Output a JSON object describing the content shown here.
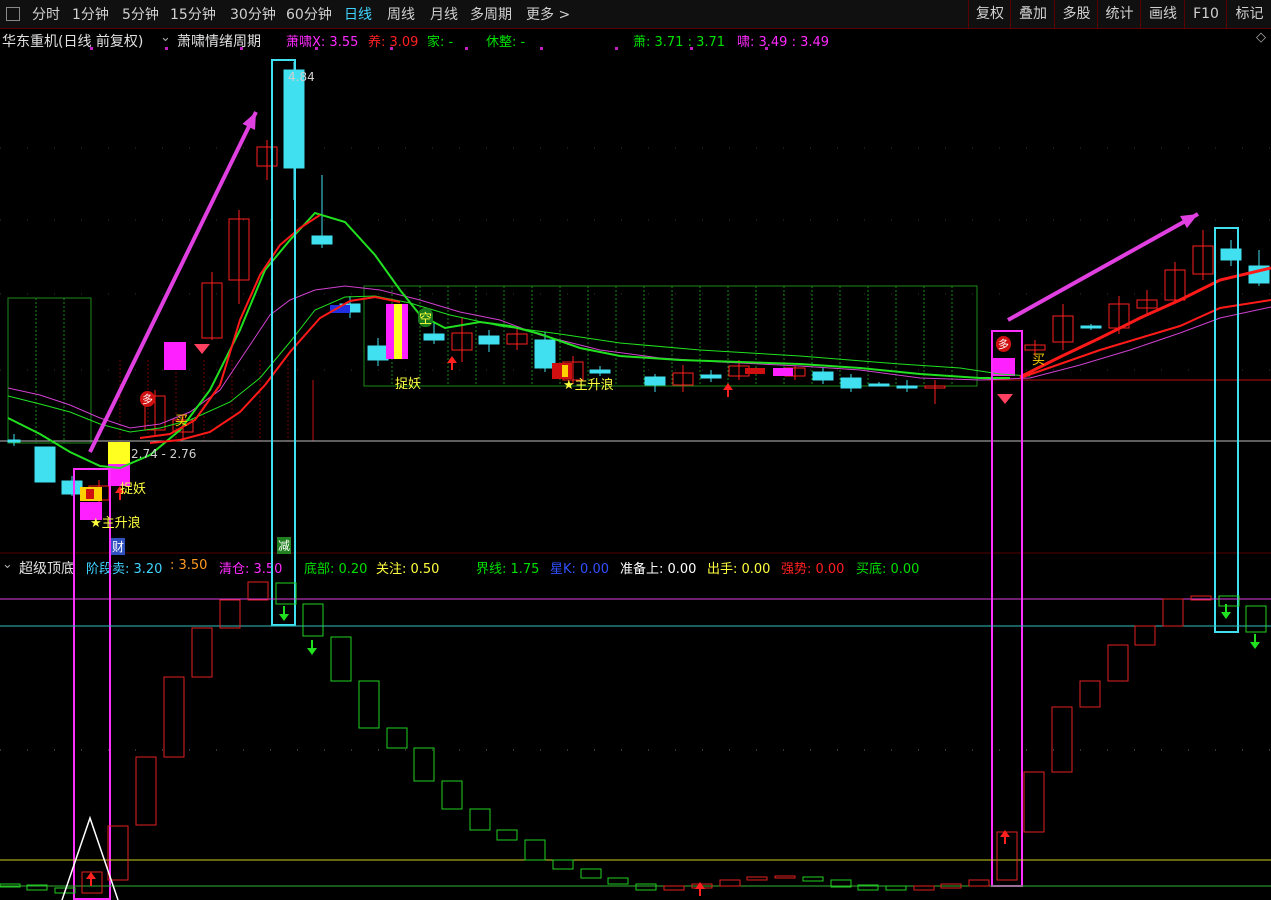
{
  "toolbar": {
    "periods": [
      "分时",
      "1分钟",
      "5分钟",
      "15分钟",
      "30分钟",
      "60分钟",
      "日线",
      "周线",
      "月线",
      "多周期",
      "更多"
    ],
    "active_period": "日线",
    "right_buttons": [
      "复权",
      "叠加",
      "多股",
      "统计",
      "画线",
      "F10",
      "标记"
    ]
  },
  "main_header": {
    "stock_name": "华东重机(日线 前复权)",
    "indicator_name": "萧啸情绪周期",
    "fields": [
      {
        "label": "萧啸X:",
        "value": "3.55",
        "color": "#ff2bff"
      },
      {
        "label": "养:",
        "value": "3.09",
        "color": "#ff2020"
      },
      {
        "label": "家:",
        "value": "-",
        "color": "#00e000"
      },
      {
        "label": "休整:",
        "value": "-",
        "color": "#00e000"
      },
      {
        "label": "萧:",
        "value": "3.71 : 3.71",
        "color": "#00e000"
      },
      {
        "label": "啸:",
        "value": "3.49 : 3.49",
        "color": "#ff2bff"
      }
    ]
  },
  "sub_header": {
    "indicator_name": "超级顶底",
    "fields": [
      {
        "label": "阶段卖:",
        "value": "3.20",
        "color": "#3fd4ff"
      },
      {
        "label": ":",
        "value": "3.50",
        "color": "#ff9a20"
      },
      {
        "label": "清仓:",
        "value": "3.50",
        "color": "#ff2bff"
      },
      {
        "label": "底部:",
        "value": "0.20",
        "color": "#00e000"
      },
      {
        "label": "关注:",
        "value": "0.50",
        "color": "#ffff40"
      },
      {
        "label": "界线:",
        "value": "1.75",
        "color": "#00e000"
      },
      {
        "label": "星K:",
        "value": "0.00",
        "color": "#3050ff"
      },
      {
        "label": "准备上:",
        "value": "0.00",
        "color": "#ffffff"
      },
      {
        "label": "出手:",
        "value": "0.00",
        "color": "#ffff40"
      },
      {
        "label": "强势:",
        "value": "0.00",
        "color": "#ff2020"
      },
      {
        "label": "买底:",
        "value": "0.00",
        "color": "#00e000"
      }
    ]
  },
  "annotations": {
    "high_price": "4.84",
    "low_range": "2.74 - 2.76",
    "catch_demon": "捉妖",
    "main_wave": "★主升浪",
    "buy": "买",
    "empty": "空",
    "duo": "多",
    "cai": "财",
    "jian": "减"
  },
  "colors": {
    "up": "#ff2020",
    "down": "#40e0f0",
    "ma_green": "#20e020",
    "ma_red": "#ff1a1a",
    "ma_magenta": "#d040d0",
    "box_magenta": "#ff30ff",
    "box_cyan": "#40e0f0"
  },
  "icons": [
    "diamond-gem-icon",
    "buy-arrow-icon",
    "sell-arrow-icon",
    "dropdown-icon"
  ]
}
